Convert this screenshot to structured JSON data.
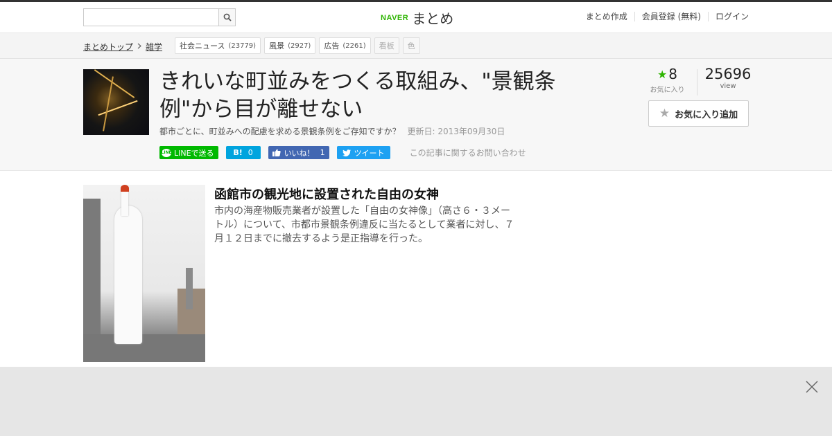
{
  "header": {
    "search_placeholder": "",
    "logo_brand": "NAVER",
    "logo_text": "まとめ",
    "links": [
      "まとめ作成",
      "会員登録 (無料)",
      "ログイン"
    ]
  },
  "breadcrumb": {
    "top": "まとめトップ",
    "category": "雑学"
  },
  "tags": [
    {
      "label": "社会ニュース",
      "count": "(23779)"
    },
    {
      "label": "風景",
      "count": "(2927)"
    },
    {
      "label": "広告",
      "count": "(2261)"
    },
    {
      "label": "看板",
      "count": ""
    },
    {
      "label": "色",
      "count": ""
    }
  ],
  "article": {
    "title": "きれいな町並みをつくる取組み、\"景観条例\"から目が離せない",
    "description": "都市ごとに、町並みへの配慮を求める景観条例をご存知ですか？",
    "updated": "更新日: 2013年09月30日",
    "share": {
      "line": "LINEで送る",
      "line_icon": "LINE",
      "hatena": "B!",
      "hatena_count": "0",
      "like": "いいね！",
      "like_count": "1",
      "tweet": "ツイート"
    },
    "inquiry": "この記事に関するお問い合わせ"
  },
  "stats": {
    "favorites": "8",
    "favorites_label": "お気に入り",
    "views": "25696",
    "views_label": "view",
    "add_favorite": "お気に入り追加"
  },
  "item": {
    "title": "函館市の観光地に設置された自由の女神",
    "description": "市内の海産物販売業者が設置した「自由の女神像」（高さ６・３メートル）について、市都市景観条例違反に当たるとして業者に対し、７月１２日までに撤去するよう是正指導を行った。"
  },
  "colors": {
    "brand_green": "#2db400",
    "line": "#00b900",
    "hatena": "#00a4de",
    "facebook": "#4267b2",
    "twitter": "#1da1f2"
  }
}
